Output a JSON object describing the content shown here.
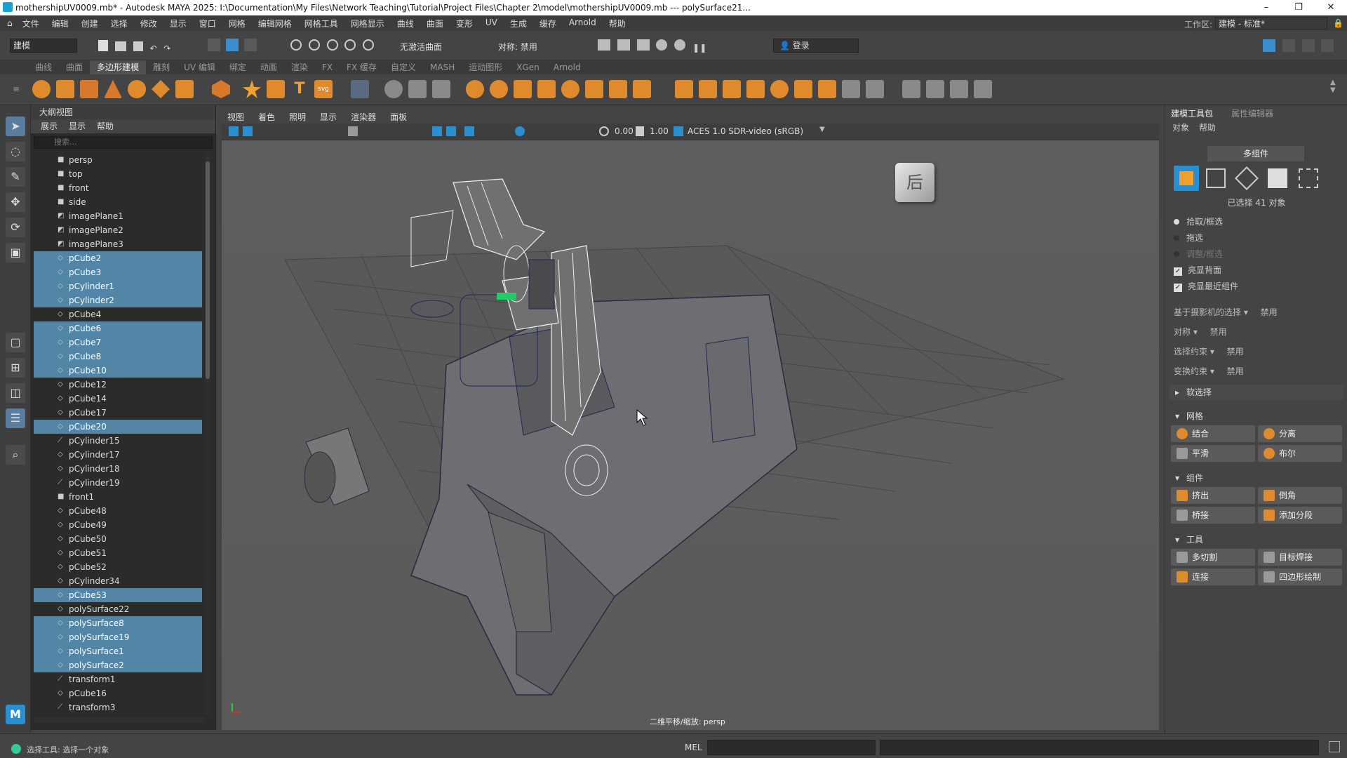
{
  "window": {
    "title": "mothershipUV0009.mb* - Autodesk MAYA 2025: I:\\Documentation\\My Files\\Network Teaching\\Tutorial\\Project Files\\Chapter 2\\model\\mothershipUV0009.mb   ---   polySurface21...",
    "minimize_icon": "–",
    "restore_icon": "❐",
    "close_icon": "✕"
  },
  "menubar": [
    "文件",
    "编辑",
    "创建",
    "选择",
    "修改",
    "显示",
    "窗口",
    "网格",
    "编辑网格",
    "网格工具",
    "网格显示",
    "曲线",
    "曲面",
    "变形",
    "UV",
    "生成",
    "缓存",
    "Arnold",
    "帮助"
  ],
  "workspace": {
    "label": "工作区:",
    "value": "建模 - 标准*"
  },
  "statusline": {
    "mode_value": "建模",
    "live_surface": "无激活曲面",
    "symmetry": "对称: 禁用",
    "login": "登录"
  },
  "shelf_tabs": [
    "曲线",
    "曲面",
    "多边形建模",
    "雕刻",
    "UV 编辑",
    "绑定",
    "动画",
    "渲染",
    "FX",
    "FX 缓存",
    "自定义",
    "MASH",
    "运动图形",
    "XGen",
    "Arnold"
  ],
  "shelf_active_tab": "多边形建模",
  "outliner": {
    "title": "大纲视图",
    "menu": [
      "展示",
      "显示",
      "帮助"
    ],
    "search_placeholder": "搜索...",
    "items": [
      {
        "label": "persp",
        "icon": "camera",
        "selected": false
      },
      {
        "label": "top",
        "icon": "camera",
        "selected": false
      },
      {
        "label": "front",
        "icon": "camera",
        "selected": false
      },
      {
        "label": "side",
        "icon": "camera",
        "selected": false
      },
      {
        "label": "imagePlane1",
        "icon": "image-plane",
        "selected": false
      },
      {
        "label": "imagePlane2",
        "icon": "image-plane",
        "selected": false
      },
      {
        "label": "imagePlane3",
        "icon": "image-plane",
        "selected": false
      },
      {
        "label": "pCube2",
        "icon": "mesh",
        "selected": true
      },
      {
        "label": "pCube3",
        "icon": "mesh",
        "selected": true
      },
      {
        "label": "pCylinder1",
        "icon": "mesh",
        "selected": true
      },
      {
        "label": "pCylinder2",
        "icon": "mesh",
        "selected": true
      },
      {
        "label": "pCube4",
        "icon": "mesh",
        "selected": false
      },
      {
        "label": "pCube6",
        "icon": "mesh",
        "selected": true
      },
      {
        "label": "pCube7",
        "icon": "mesh",
        "selected": true
      },
      {
        "label": "pCube8",
        "icon": "mesh",
        "selected": true
      },
      {
        "label": "pCube10",
        "icon": "mesh",
        "selected": true
      },
      {
        "label": "pCube12",
        "icon": "mesh",
        "selected": false
      },
      {
        "label": "pCube14",
        "icon": "mesh",
        "selected": false
      },
      {
        "label": "pCube17",
        "icon": "mesh",
        "selected": false
      },
      {
        "label": "pCube20",
        "icon": "mesh",
        "selected": true
      },
      {
        "label": "pCylinder15",
        "icon": "transform",
        "selected": false
      },
      {
        "label": "pCylinder17",
        "icon": "mesh",
        "selected": false
      },
      {
        "label": "pCylinder18",
        "icon": "mesh",
        "selected": false
      },
      {
        "label": "pCylinder19",
        "icon": "transform",
        "selected": false
      },
      {
        "label": "front1",
        "icon": "camera",
        "selected": false
      },
      {
        "label": "pCube48",
        "icon": "mesh",
        "selected": false
      },
      {
        "label": "pCube49",
        "icon": "mesh",
        "selected": false
      },
      {
        "label": "pCube50",
        "icon": "mesh",
        "selected": false
      },
      {
        "label": "pCube51",
        "icon": "mesh",
        "selected": false
      },
      {
        "label": "pCube52",
        "icon": "mesh",
        "selected": false
      },
      {
        "label": "pCylinder34",
        "icon": "mesh",
        "selected": false
      },
      {
        "label": "pCube53",
        "icon": "mesh",
        "selected": true
      },
      {
        "label": "polySurface22",
        "icon": "mesh",
        "selected": false
      },
      {
        "label": "polySurface8",
        "icon": "mesh",
        "selected": true
      },
      {
        "label": "polySurface19",
        "icon": "mesh",
        "selected": true
      },
      {
        "label": "polySurface1",
        "icon": "mesh",
        "selected": true
      },
      {
        "label": "polySurface2",
        "icon": "mesh",
        "selected": true
      },
      {
        "label": "transform1",
        "icon": "transform",
        "selected": false
      },
      {
        "label": "pCube16",
        "icon": "mesh",
        "selected": false
      },
      {
        "label": "transform3",
        "icon": "transform",
        "selected": false
      }
    ]
  },
  "viewport": {
    "menu": [
      "视图",
      "着色",
      "照明",
      "显示",
      "渲染器",
      "面板"
    ],
    "exposure": "0.00",
    "gamma": "1.00",
    "color_space": "ACES 1.0 SDR-video (sRGB)",
    "camera_label": "二维平移/缩放: persp",
    "viewcube_face": "后"
  },
  "right_panel": {
    "tabs": [
      "建模工具包",
      "属性编辑器"
    ],
    "menu": [
      "对象",
      "帮助"
    ],
    "multi_component": "多组件",
    "selected_count": "已选择 41 对象",
    "options": [
      {
        "label": "拾取/框选",
        "type": "radio",
        "checked": true
      },
      {
        "label": "拖选",
        "type": "radio",
        "checked": false
      },
      {
        "label": "调整/框选",
        "type": "radio",
        "checked": false,
        "disabled": true
      },
      {
        "label": "亮显背面",
        "type": "checkbox",
        "checked": true
      },
      {
        "label": "亮显最近组件",
        "type": "checkbox",
        "checked": true
      }
    ],
    "camera_based": {
      "label": "基于摄影机的选择",
      "value": "禁用"
    },
    "symmetry": {
      "label": "对称",
      "value": "禁用"
    },
    "select_constraint": {
      "label": "选择约束",
      "value": "禁用"
    },
    "transform_constraint": {
      "label": "变换约束",
      "value": "禁用"
    },
    "soft_select": "软选择",
    "sections": {
      "mesh": {
        "title": "网格",
        "buttons": [
          "结合",
          "分离",
          "平滑",
          "布尔"
        ]
      },
      "components": {
        "title": "组件",
        "buttons": [
          "挤出",
          "倒角",
          "桥接",
          "添加分段"
        ]
      },
      "tools": {
        "title": "工具",
        "buttons": [
          "多切割",
          "目标焊接",
          "连接",
          "四边形绘制"
        ]
      }
    }
  },
  "bottombar": {
    "mel_label": "MEL",
    "help_line": "选择工具: 选择一个对象"
  },
  "colors": {
    "selection": "#5285a6",
    "viewport_bg": "#5c5c5c",
    "accent": "#3a8fd0"
  }
}
